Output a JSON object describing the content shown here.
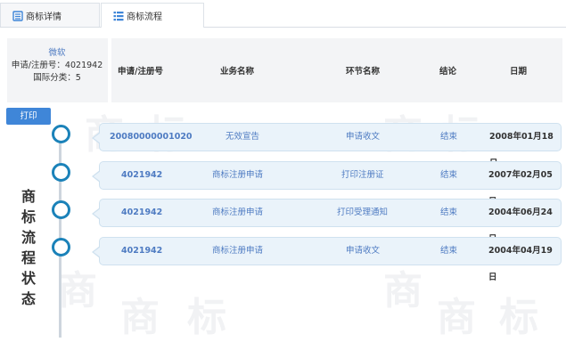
{
  "tabs": [
    {
      "label": "商标详情"
    },
    {
      "label": "商标流程"
    }
  ],
  "info": {
    "owner": "微软",
    "reg_no": "申请/注册号：4021942",
    "class": "国际分类：5"
  },
  "columns": [
    "申请/注册号",
    "业务名称",
    "环节名称",
    "结论",
    "日期"
  ],
  "print_label": "打印",
  "side_title": [
    "商",
    "标",
    "流",
    "程",
    "状",
    "态"
  ],
  "watermark": "商标",
  "rows": [
    {
      "number": "20080000001020",
      "business": "无效宣告",
      "step": "申请收文",
      "result": "结束",
      "date": "2008年01月18日"
    },
    {
      "number": "4021942",
      "business": "商标注册申请",
      "step": "打印注册证",
      "result": "结束",
      "date": "2007年02月05日"
    },
    {
      "number": "4021942",
      "business": "商标注册申请",
      "step": "打印受理通知",
      "result": "结束",
      "date": "2004年06月24日"
    },
    {
      "number": "4021942",
      "business": "商标注册申请",
      "step": "申请收文",
      "result": "结束",
      "date": "2004年04月19日"
    }
  ],
  "colors": {
    "accent": "#3f86d8",
    "link": "#4e7bc2",
    "dot": "#1b82b9",
    "card": "#eaf3fa"
  }
}
